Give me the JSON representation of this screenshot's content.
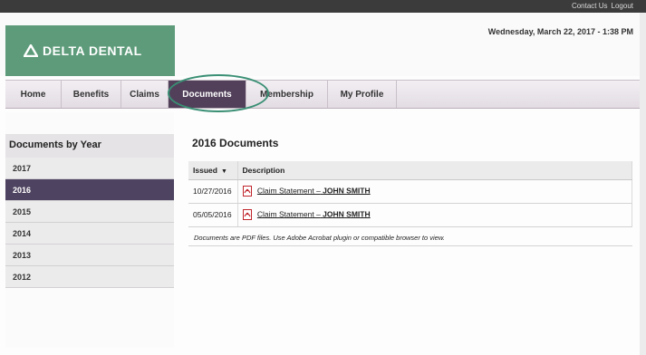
{
  "top_links": [
    "Contact Us",
    "Logout"
  ],
  "brand": {
    "name": "DELTA DENTAL",
    "color": "#5d9b7a"
  },
  "datetime": "Wednesday, March 22, 2017 - 1:38 PM",
  "nav": {
    "items": [
      {
        "label": "Home",
        "active": false
      },
      {
        "label": "Benefits",
        "active": false
      },
      {
        "label": "Claims",
        "active": false
      },
      {
        "label": "Documents",
        "active": true
      },
      {
        "label": "Membership",
        "active": false
      },
      {
        "label": "My Profile",
        "active": false
      }
    ],
    "active_color": "#52405a",
    "highlight_color": "#3a8f74"
  },
  "sidebar": {
    "title": "Documents by Year",
    "years": [
      {
        "label": "2017",
        "active": false
      },
      {
        "label": "2016",
        "active": true
      },
      {
        "label": "2015",
        "active": false
      },
      {
        "label": "2014",
        "active": false
      },
      {
        "label": "2013",
        "active": false
      },
      {
        "label": "2012",
        "active": false
      }
    ]
  },
  "main": {
    "title": "2016 Documents",
    "columns": [
      "Issued",
      "Description"
    ],
    "rows": [
      {
        "issued": "10/27/2016",
        "description": "Claim Statement –",
        "name": "JOHN SMITH"
      },
      {
        "issued": "05/05/2016",
        "description": "Claim Statement –",
        "name": "JOHN SMITH"
      }
    ],
    "note": "Documents are PDF files. Use Adobe Acrobat plugin or compatible browser to view."
  },
  "icons": {
    "logo": "delta-triangle-icon",
    "sort": "sort-down-icon",
    "pdf": "pdf-icon"
  }
}
